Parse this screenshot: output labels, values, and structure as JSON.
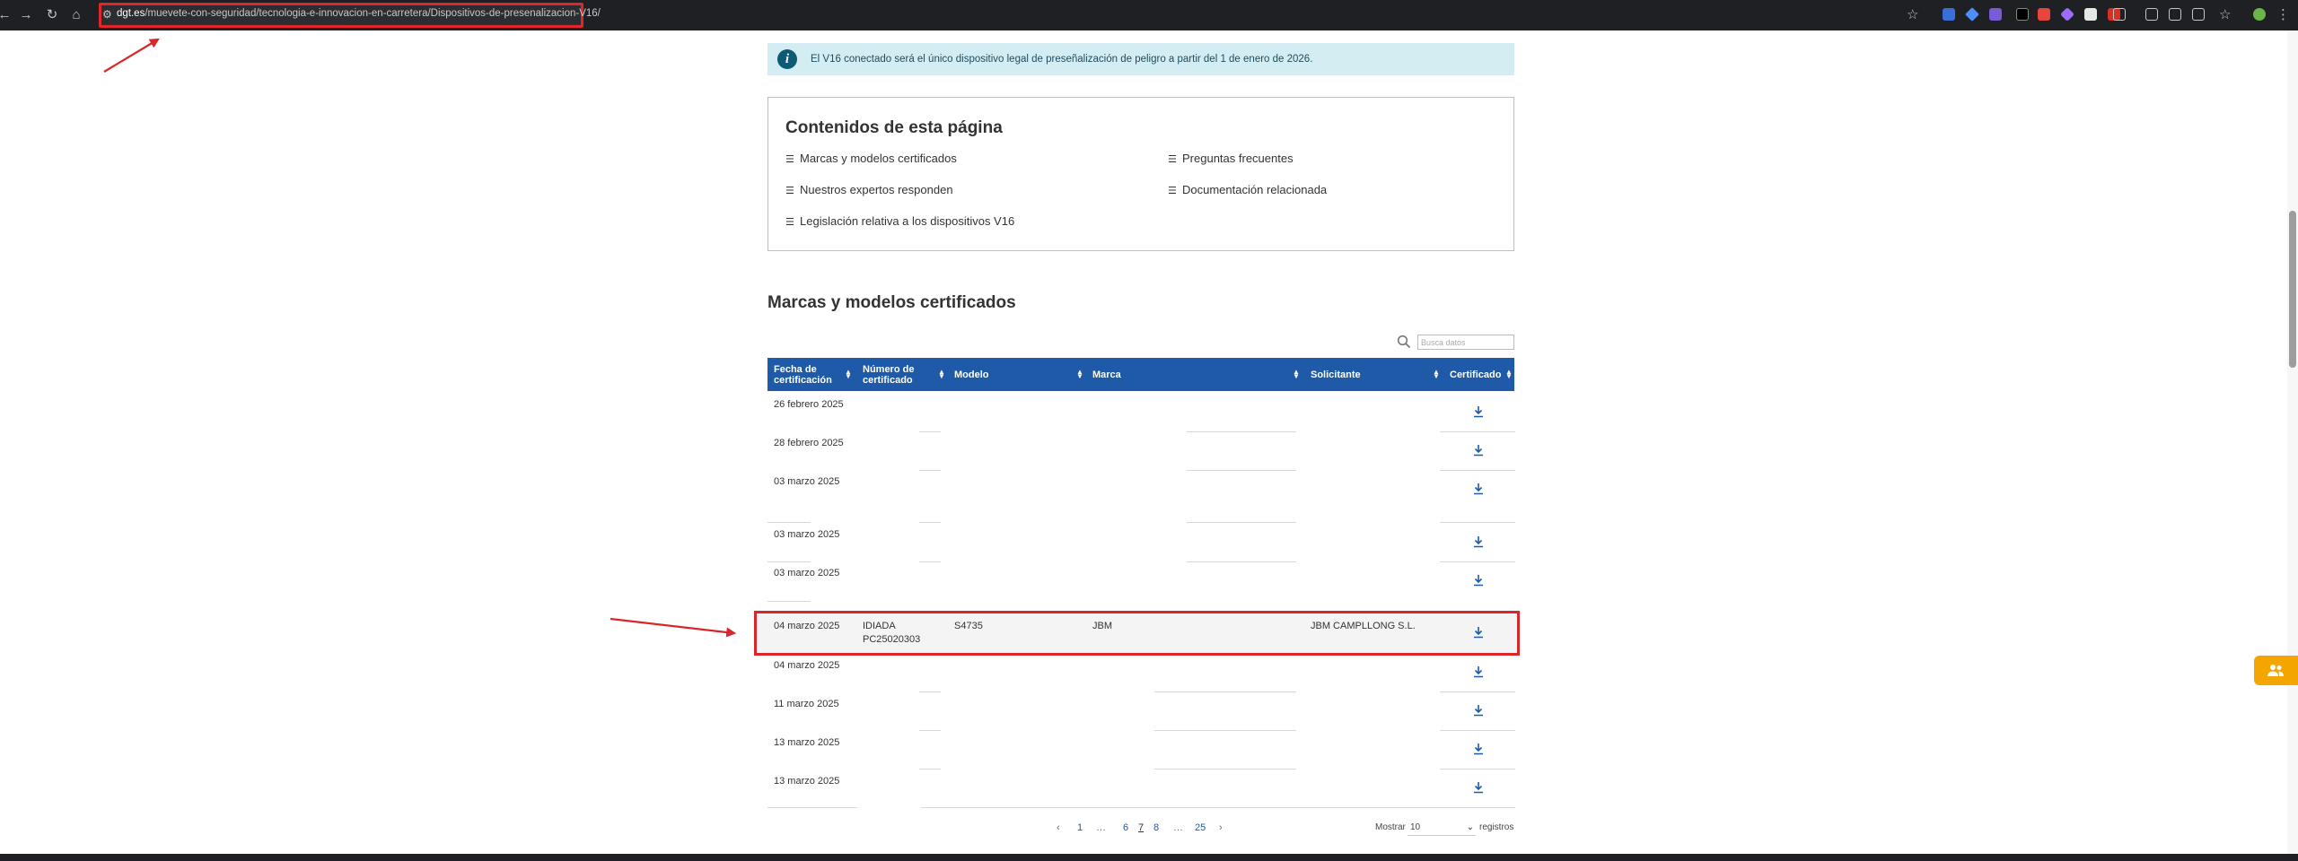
{
  "browser": {
    "url_host": "dgt.es",
    "url_path": "/muevete-con-seguridad/tecnologia-e-innovacion-en-carretera/Dispositivos-de-presenalizacion-V16/"
  },
  "banner": {
    "text": "El V16 conectado será el único dispositivo legal de preseñalización de peligro a partir del 1 de enero de 2026."
  },
  "toc": {
    "title": "Contenidos de esta página",
    "items": [
      "Marcas y modelos certificados",
      "Preguntas frecuentes",
      "Nuestros expertos responden",
      "Documentación relacionada",
      "Legislación relativa a los dispositivos V16"
    ]
  },
  "section": {
    "title": "Marcas y modelos certificados"
  },
  "search": {
    "placeholder": "Busca datos"
  },
  "table": {
    "headers": {
      "fecha": "Fecha de certificación",
      "numero": "Número de certificado",
      "modelo": "Modelo",
      "marca": "Marca",
      "solicitante": "Solicitante",
      "certificado": "Certificado"
    },
    "rows": [
      {
        "fecha": "26 febrero 2025"
      },
      {
        "fecha": "28 febrero 2025"
      },
      {
        "fecha": "03 marzo 2025"
      },
      {
        "fecha": "03 marzo 2025"
      },
      {
        "fecha": "03 marzo 2025"
      },
      {
        "fecha": "04 marzo 2025",
        "numero_1": "IDIADA",
        "numero_2": "PC25020303",
        "modelo": "S4735",
        "marca": "JBM",
        "solicitante": "JBM CAMPLLONG S.L."
      },
      {
        "fecha": "04 marzo 2025"
      },
      {
        "fecha": "11 marzo 2025"
      },
      {
        "fecha": "13 marzo 2025"
      },
      {
        "fecha": "13 marzo 2025"
      }
    ]
  },
  "pagination": {
    "prev": "‹",
    "p1": "1",
    "ellipsis1": "…",
    "p6": "6",
    "p7": "7",
    "p8": "8",
    "ellipsis2": "…",
    "p25": "25",
    "next": "›",
    "mostrar_label": "Mostrar",
    "page_size": "10",
    "registros_label": "registros"
  },
  "colors": {
    "table_header": "#1f5aa8",
    "highlight_border": "#d9262a",
    "banner_bg": "#d4edf3",
    "side_button": "#f5a500"
  }
}
